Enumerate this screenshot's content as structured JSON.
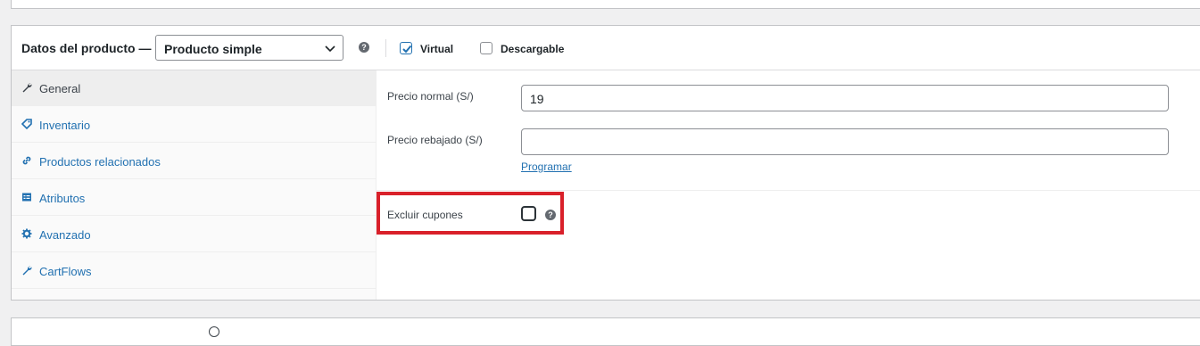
{
  "header": {
    "title": "Datos del producto —",
    "product_type": "Producto simple",
    "help_icon": "question-circle-icon",
    "virtual": {
      "label": "Virtual",
      "checked": true
    },
    "downloadable": {
      "label": "Descargable",
      "checked": false
    }
  },
  "sidebar": {
    "items": [
      {
        "label": "General",
        "icon": "wrench-icon",
        "active": true
      },
      {
        "label": "Inventario",
        "icon": "tag-icon",
        "active": false
      },
      {
        "label": "Productos relacionados",
        "icon": "link-icon",
        "active": false
      },
      {
        "label": "Atributos",
        "icon": "list-icon",
        "active": false
      },
      {
        "label": "Avanzado",
        "icon": "gear-icon",
        "active": false
      },
      {
        "label": "CartFlows",
        "icon": "wrench-icon",
        "active": false
      }
    ]
  },
  "general": {
    "regular_price_label": "Precio normal (S/)",
    "regular_price_value": "19",
    "sale_price_label": "Precio rebajado (S/)",
    "sale_price_value": "",
    "schedule_link": "Programar",
    "exclude_coupons_label": "Excluir cupones",
    "exclude_coupons_checked": false
  },
  "colors": {
    "accent": "#2271b1",
    "highlight": "#d9202a"
  }
}
